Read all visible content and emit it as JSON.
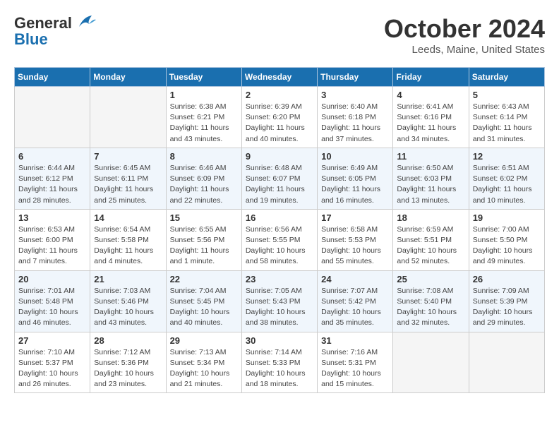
{
  "header": {
    "logo_line1": "General",
    "logo_line2": "Blue",
    "month": "October 2024",
    "location": "Leeds, Maine, United States"
  },
  "days_of_week": [
    "Sunday",
    "Monday",
    "Tuesday",
    "Wednesday",
    "Thursday",
    "Friday",
    "Saturday"
  ],
  "weeks": [
    [
      {
        "day": "",
        "empty": true
      },
      {
        "day": "",
        "empty": true
      },
      {
        "day": "1",
        "sunrise": "6:38 AM",
        "sunset": "6:21 PM",
        "daylight": "11 hours and 43 minutes."
      },
      {
        "day": "2",
        "sunrise": "6:39 AM",
        "sunset": "6:20 PM",
        "daylight": "11 hours and 40 minutes."
      },
      {
        "day": "3",
        "sunrise": "6:40 AM",
        "sunset": "6:18 PM",
        "daylight": "11 hours and 37 minutes."
      },
      {
        "day": "4",
        "sunrise": "6:41 AM",
        "sunset": "6:16 PM",
        "daylight": "11 hours and 34 minutes."
      },
      {
        "day": "5",
        "sunrise": "6:43 AM",
        "sunset": "6:14 PM",
        "daylight": "11 hours and 31 minutes."
      }
    ],
    [
      {
        "day": "6",
        "sunrise": "6:44 AM",
        "sunset": "6:12 PM",
        "daylight": "11 hours and 28 minutes."
      },
      {
        "day": "7",
        "sunrise": "6:45 AM",
        "sunset": "6:11 PM",
        "daylight": "11 hours and 25 minutes."
      },
      {
        "day": "8",
        "sunrise": "6:46 AM",
        "sunset": "6:09 PM",
        "daylight": "11 hours and 22 minutes."
      },
      {
        "day": "9",
        "sunrise": "6:48 AM",
        "sunset": "6:07 PM",
        "daylight": "11 hours and 19 minutes."
      },
      {
        "day": "10",
        "sunrise": "6:49 AM",
        "sunset": "6:05 PM",
        "daylight": "11 hours and 16 minutes."
      },
      {
        "day": "11",
        "sunrise": "6:50 AM",
        "sunset": "6:03 PM",
        "daylight": "11 hours and 13 minutes."
      },
      {
        "day": "12",
        "sunrise": "6:51 AM",
        "sunset": "6:02 PM",
        "daylight": "11 hours and 10 minutes."
      }
    ],
    [
      {
        "day": "13",
        "sunrise": "6:53 AM",
        "sunset": "6:00 PM",
        "daylight": "11 hours and 7 minutes."
      },
      {
        "day": "14",
        "sunrise": "6:54 AM",
        "sunset": "5:58 PM",
        "daylight": "11 hours and 4 minutes."
      },
      {
        "day": "15",
        "sunrise": "6:55 AM",
        "sunset": "5:56 PM",
        "daylight": "11 hours and 1 minute."
      },
      {
        "day": "16",
        "sunrise": "6:56 AM",
        "sunset": "5:55 PM",
        "daylight": "10 hours and 58 minutes."
      },
      {
        "day": "17",
        "sunrise": "6:58 AM",
        "sunset": "5:53 PM",
        "daylight": "10 hours and 55 minutes."
      },
      {
        "day": "18",
        "sunrise": "6:59 AM",
        "sunset": "5:51 PM",
        "daylight": "10 hours and 52 minutes."
      },
      {
        "day": "19",
        "sunrise": "7:00 AM",
        "sunset": "5:50 PM",
        "daylight": "10 hours and 49 minutes."
      }
    ],
    [
      {
        "day": "20",
        "sunrise": "7:01 AM",
        "sunset": "5:48 PM",
        "daylight": "10 hours and 46 minutes."
      },
      {
        "day": "21",
        "sunrise": "7:03 AM",
        "sunset": "5:46 PM",
        "daylight": "10 hours and 43 minutes."
      },
      {
        "day": "22",
        "sunrise": "7:04 AM",
        "sunset": "5:45 PM",
        "daylight": "10 hours and 40 minutes."
      },
      {
        "day": "23",
        "sunrise": "7:05 AM",
        "sunset": "5:43 PM",
        "daylight": "10 hours and 38 minutes."
      },
      {
        "day": "24",
        "sunrise": "7:07 AM",
        "sunset": "5:42 PM",
        "daylight": "10 hours and 35 minutes."
      },
      {
        "day": "25",
        "sunrise": "7:08 AM",
        "sunset": "5:40 PM",
        "daylight": "10 hours and 32 minutes."
      },
      {
        "day": "26",
        "sunrise": "7:09 AM",
        "sunset": "5:39 PM",
        "daylight": "10 hours and 29 minutes."
      }
    ],
    [
      {
        "day": "27",
        "sunrise": "7:10 AM",
        "sunset": "5:37 PM",
        "daylight": "10 hours and 26 minutes."
      },
      {
        "day": "28",
        "sunrise": "7:12 AM",
        "sunset": "5:36 PM",
        "daylight": "10 hours and 23 minutes."
      },
      {
        "day": "29",
        "sunrise": "7:13 AM",
        "sunset": "5:34 PM",
        "daylight": "10 hours and 21 minutes."
      },
      {
        "day": "30",
        "sunrise": "7:14 AM",
        "sunset": "5:33 PM",
        "daylight": "10 hours and 18 minutes."
      },
      {
        "day": "31",
        "sunrise": "7:16 AM",
        "sunset": "5:31 PM",
        "daylight": "10 hours and 15 minutes."
      },
      {
        "day": "",
        "empty": true
      },
      {
        "day": "",
        "empty": true
      }
    ]
  ]
}
